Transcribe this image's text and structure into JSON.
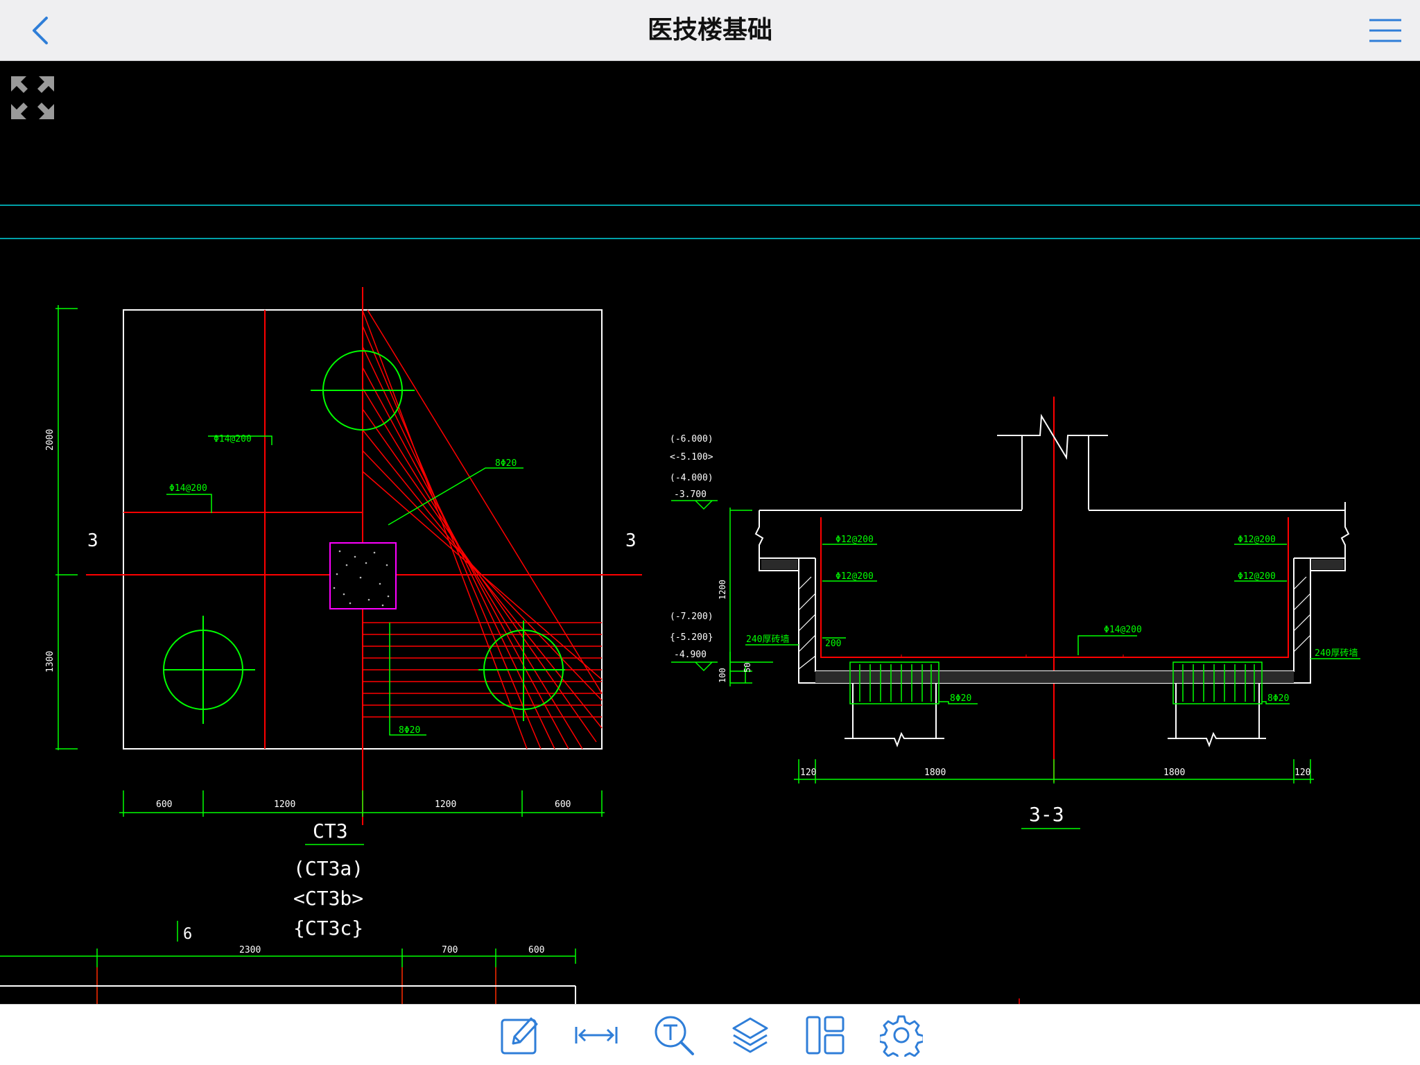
{
  "header": {
    "title": "医技楼基础"
  },
  "icons": {
    "back": "chevron-left-icon",
    "menu": "hamburger-menu-icon",
    "fullscreen": "expand-arrows-icon",
    "toolbar": [
      "pencil-edit-icon",
      "measure-arrows-icon",
      "text-search-icon",
      "layers-icon",
      "layout-panels-icon",
      "gear-icon"
    ]
  },
  "colors": {
    "accent": "#2f7ed8",
    "drawing_bg": "#000000",
    "line_green": "#00ff00",
    "line_red": "#ff0000",
    "line_white": "#ffffff",
    "line_cyan": "#00a0a8",
    "column_magenta": "#ff00ff"
  },
  "drawing": {
    "plan": {
      "section_mark_left": "3",
      "section_mark_right": "3",
      "rebar_1": "Φ14@200",
      "rebar_2": "Φ14@200",
      "rebar_diag": "8Φ20",
      "rebar_bottom": "8Φ20",
      "dim_vertical": [
        "2000",
        "1300"
      ],
      "dim_horizontal": [
        "600",
        "1200",
        "1200",
        "600"
      ],
      "name": "CT3",
      "variants": [
        "(CT3a)",
        "<CT3b>",
        "{CT3c}"
      ]
    },
    "section": {
      "elev_1": "(-6.000)",
      "elev_2": "<-5.100>",
      "elev_3": "(-4.000)",
      "elev_4": "-3.700",
      "elev_5": "(-7.200)",
      "elev_6": "{-5.200}",
      "elev_7": "-4.900",
      "dim_1200": "1200",
      "dim_100": "100",
      "dim_50": "50",
      "rebar_left_1": "Φ12@200",
      "rebar_left_2": "Φ12@200",
      "rebar_right_1": "Φ12@200",
      "rebar_right_2": "Φ12@200",
      "rebar_bottom": "Φ14@200",
      "val_200": "200",
      "wall_left": "240厚砖墙",
      "wall_right": "240厚砖墙",
      "pile_left": "8Φ20",
      "pile_right": "8Φ20",
      "dims_bottom": [
        "120",
        "1800",
        "1800",
        "120"
      ],
      "title": "3-3"
    },
    "bottom": {
      "axis": "6",
      "dims": [
        "2300",
        "700",
        "600"
      ]
    }
  }
}
